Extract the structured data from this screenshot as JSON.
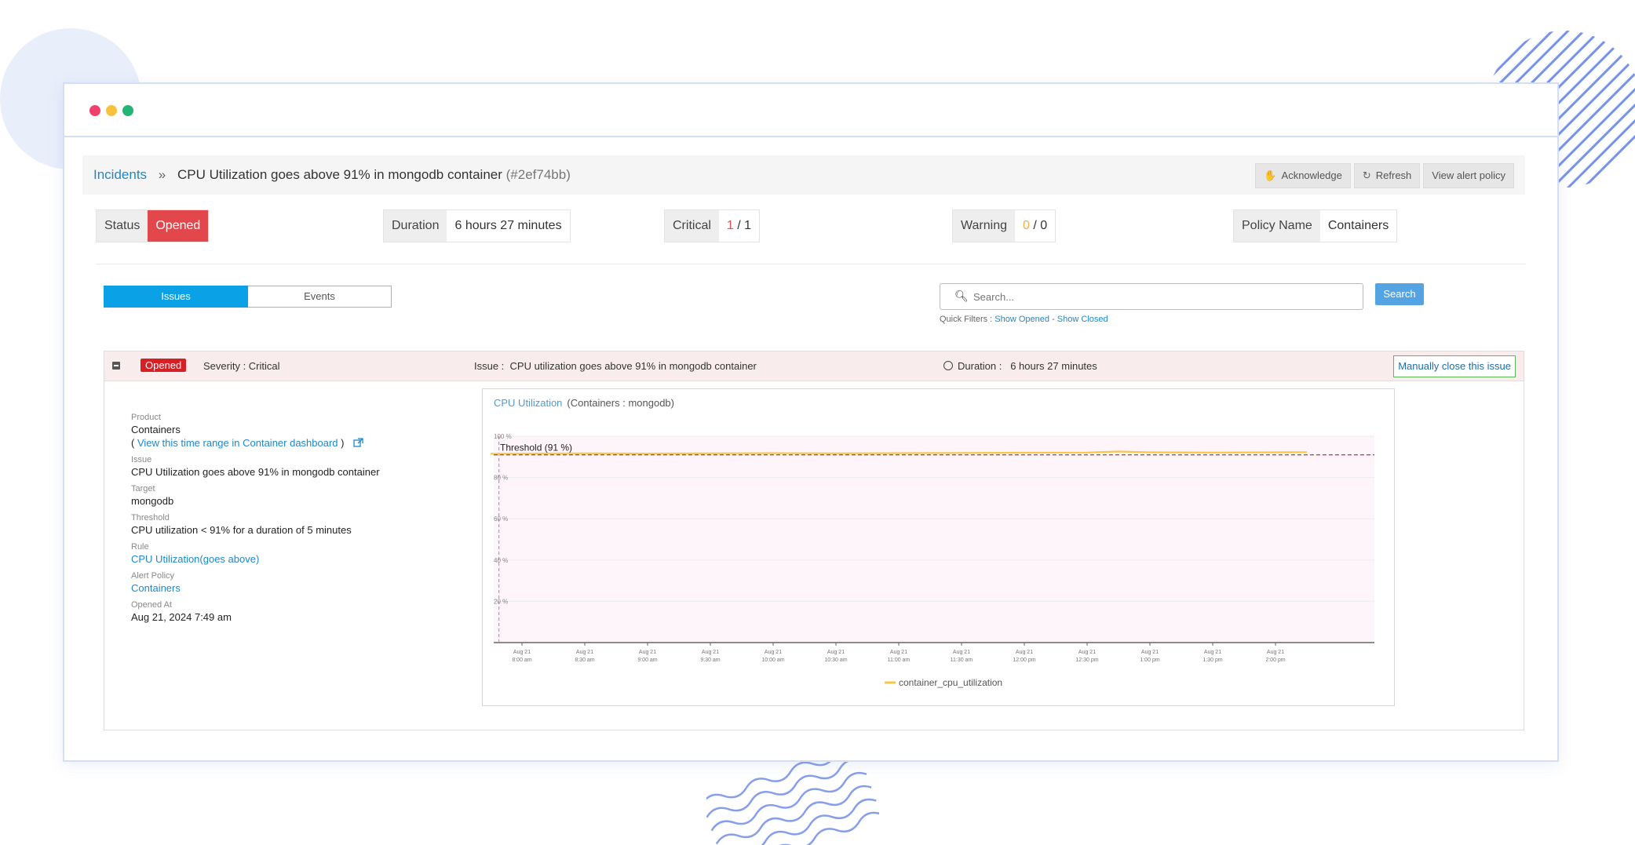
{
  "header": {
    "breadcrumb_root": "Incidents",
    "breadcrumb_separator": "»",
    "title": "CPU Utilization goes above 91% in mongodb container",
    "incident_id": "(#2ef74bb)",
    "buttons": {
      "acknowledge": "Acknowledge",
      "refresh": "Refresh",
      "view_alert_policy": "View alert policy"
    }
  },
  "summary": {
    "status": {
      "label": "Status",
      "value": "Opened"
    },
    "duration": {
      "label": "Duration",
      "value": "6 hours 27 minutes"
    },
    "critical": {
      "label": "Critical",
      "current": "1",
      "sep": " / ",
      "total": "1"
    },
    "warning": {
      "label": "Warning",
      "current": "0",
      "sep": " / ",
      "total": "0"
    },
    "policy": {
      "label": "Policy Name",
      "value": "Containers"
    }
  },
  "tabs": [
    {
      "label": "Issues",
      "active": true
    },
    {
      "label": "Events",
      "active": false
    }
  ],
  "search": {
    "placeholder": "Search...",
    "button": "Search",
    "quick_filters_label": "Quick Filters : ",
    "show_opened": "Show Opened",
    "filter_sep": " - ",
    "show_closed": "Show Closed"
  },
  "issue": {
    "status_badge": "Opened",
    "severity": "Severity : Critical",
    "issue_text": "Issue :  CPU utilization goes above 91% in mongodb container",
    "duration_text": "Duration :   6 hours 27 minutes",
    "close_button": "Manually close this issue",
    "details": {
      "product_label": "Product",
      "product": "Containers",
      "dashboard_link_open": "( ",
      "dashboard_link": "View this time range in Container dashboard",
      "dashboard_link_close": " )",
      "issue_label": "Issue",
      "issue": "CPU Utilization goes above 91% in mongodb container",
      "target_label": "Target",
      "target": "mongodb",
      "threshold_label": "Threshold",
      "threshold": "CPU utilization < 91% for a duration of 5 minutes",
      "rule_label": "Rule",
      "rule": "CPU Utilization(goes above)",
      "alert_policy_label": "Alert Policy",
      "alert_policy": "Containers",
      "opened_at_label": "Opened At",
      "opened_at": "Aug 21, 2024 7:49 am"
    }
  },
  "chart_header": {
    "metric": "CPU Utilization",
    "context": "(Containers : mongodb)"
  },
  "chart_data": {
    "type": "line",
    "title": "CPU Utilization",
    "subtitle": "(Containers : mongodb)",
    "ylim": [
      0,
      100
    ],
    "y_ticks": [
      "20 %",
      "40 %",
      "60 %",
      "80 %",
      "100 %"
    ],
    "y_tick_values": [
      20,
      40,
      60,
      80,
      100
    ],
    "x_ticks": [
      [
        "Aug 21",
        "8:00 am"
      ],
      [
        "Aug 21",
        "8:30 am"
      ],
      [
        "Aug 21",
        "9:00 am"
      ],
      [
        "Aug 21",
        "9:30 am"
      ],
      [
        "Aug 21",
        "10:00 am"
      ],
      [
        "Aug 21",
        "10:30 am"
      ],
      [
        "Aug 21",
        "11:00 am"
      ],
      [
        "Aug 21",
        "11:30 am"
      ],
      [
        "Aug 21",
        "12:00 pm"
      ],
      [
        "Aug 21",
        "12:30 pm"
      ],
      [
        "Aug 21",
        "1:00 pm"
      ],
      [
        "Aug 21",
        "1:30 pm"
      ],
      [
        "Aug 21",
        "2:00 pm"
      ]
    ],
    "threshold": {
      "label": "Threshold (91 %)",
      "value": 91
    },
    "opened_marker": "7:49 am",
    "series": [
      {
        "name": "container_cpu_utilization",
        "color": "#f7c64b",
        "x": [
          "7:45 am",
          "8:00 am",
          "8:30 am",
          "9:00 am",
          "9:30 am",
          "10:00 am",
          "10:30 am",
          "11:00 am",
          "11:30 am",
          "12:00 pm",
          "12:30 pm",
          "12:45 pm",
          "1:00 pm",
          "1:30 pm",
          "2:00 pm",
          "2:15 pm"
        ],
        "values": [
          91.5,
          91.6,
          91.7,
          91.6,
          91.7,
          91.8,
          91.7,
          91.8,
          91.9,
          92.0,
          92.1,
          92.6,
          92.2,
          92.1,
          92.2,
          92.3
        ]
      }
    ],
    "grid": true,
    "legend": "bottom-center"
  },
  "colors": {
    "accent": "#0aa1e7",
    "critical": "#d71f26",
    "link": "#1f87c9",
    "series": "#f7c64b",
    "threshold": "#d9534f"
  }
}
